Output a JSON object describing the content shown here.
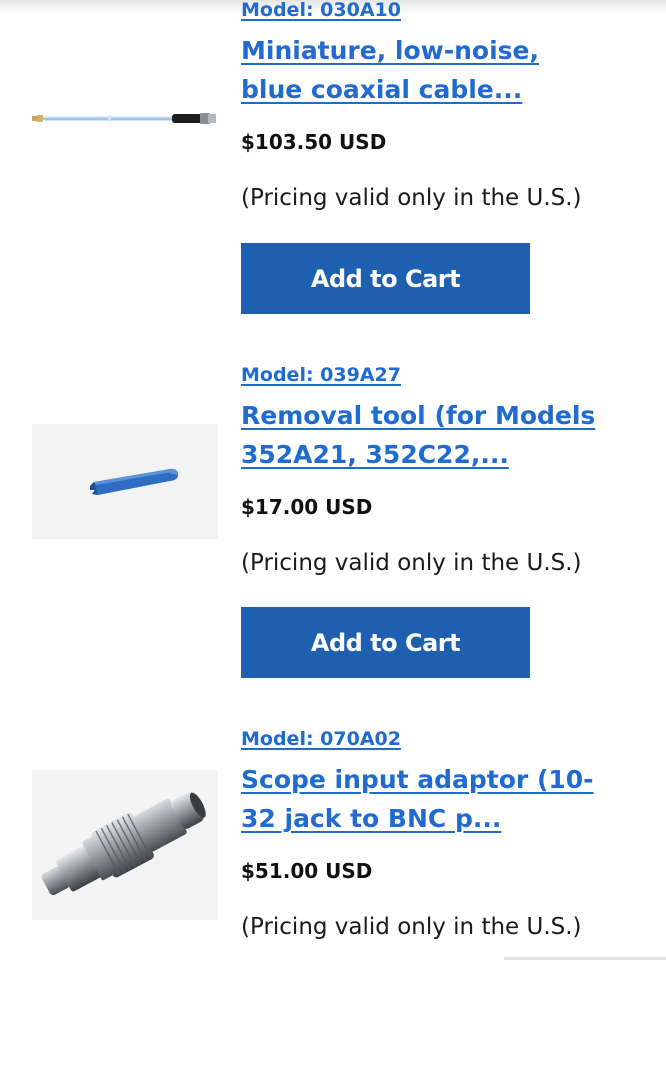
{
  "products": [
    {
      "model": "Model: 030A10",
      "title": "Miniature, low-noise, blue coaxial cable...",
      "price": "$103.50 USD",
      "pricing_note": "(Pricing valid only in the U.S.)",
      "button_label": "Add to Cart",
      "image_icon": "coaxial-cable-image"
    },
    {
      "model": "Model: 039A27",
      "title": "Removal tool (for Models 352A21, 352C22,...",
      "price": "$17.00 USD",
      "pricing_note": "(Pricing valid only in the U.S.)",
      "button_label": "Add to Cart",
      "image_icon": "removal-tool-image"
    },
    {
      "model": "Model: 070A02",
      "title": "Scope input adaptor (10-32 jack to BNC p...",
      "price": "$51.00 USD",
      "pricing_note": "(Pricing valid only in the U.S.)",
      "image_icon": "bnc-adaptor-image"
    }
  ],
  "colors": {
    "link": "#1f6bd0",
    "button": "#1f5fb0",
    "text": "#111111"
  }
}
